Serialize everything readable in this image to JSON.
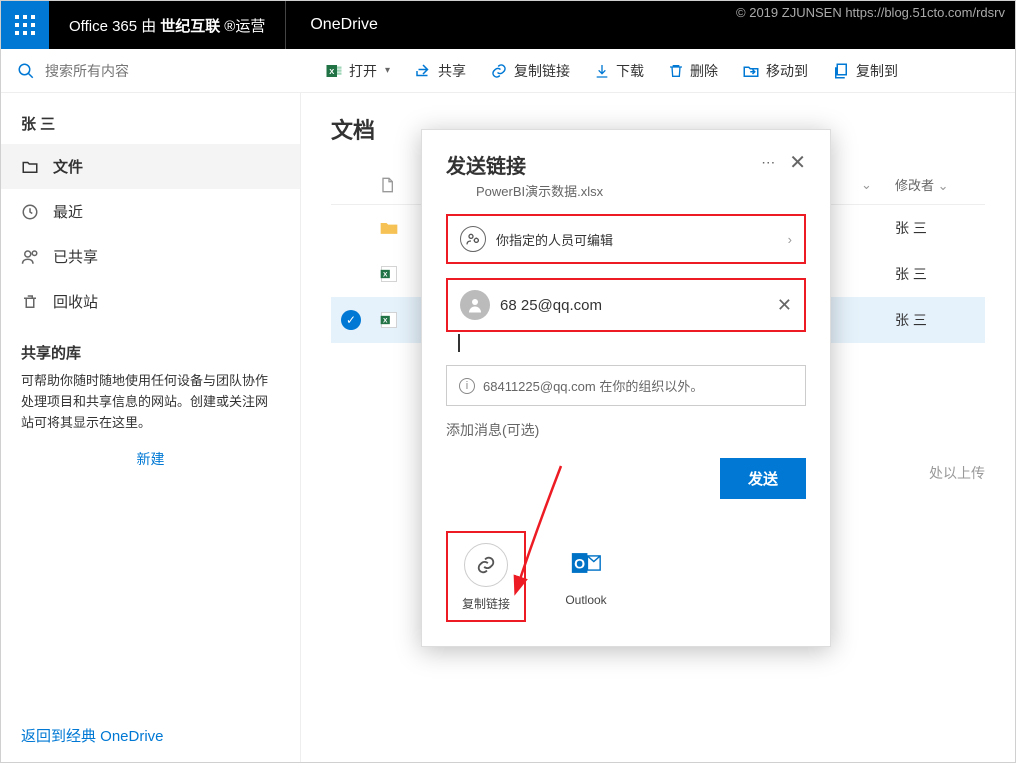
{
  "watermark": "© 2019 ZJUNSEN https://blog.51cto.com/rdsrv",
  "topbar": {
    "brand_prefix": "Office 365 由",
    "brand_bold": "世纪互联",
    "brand_suffix": "®运营",
    "product": "OneDrive"
  },
  "search": {
    "placeholder": "搜索所有内容"
  },
  "commands": {
    "open": "打开",
    "share": "共享",
    "copylink": "复制链接",
    "download": "下载",
    "delete": "删除",
    "moveto": "移动到",
    "copyto": "复制到"
  },
  "sidebar": {
    "user": "张 三",
    "files": "文件",
    "recent": "最近",
    "shared": "已共享",
    "recycle": "回收站",
    "shared_libs_hdr": "共享的库",
    "help_text": "可帮助你随时随地使用任何设备与团队协作处理项目和共享信息的网站。创建或关注网站可将其显示在这里。",
    "new_link": "新建",
    "return_link": "返回到经典 OneDrive"
  },
  "content": {
    "title": "文档",
    "cols": {
      "name_chev": "",
      "modified_by": "修改者"
    },
    "rows": [
      {
        "type": "folder",
        "modified_by": "张 三"
      },
      {
        "type": "excel",
        "modified_by": "张 三"
      },
      {
        "type": "excel",
        "selected": true,
        "modified_by": "张 三"
      }
    ],
    "upload_hint": "处以上传"
  },
  "dialog": {
    "title": "发送链接",
    "filename": "PowerBI演示数据.xlsx",
    "permission_text": "你指定的人员可编辑",
    "recipient_email_display": "68          25@qq.com",
    "info_text": "68411225@qq.com 在你的组织以外。",
    "msg_placeholder": "添加消息(可选)",
    "send_btn": "发送",
    "action_copylink": "复制链接",
    "action_outlook": "Outlook"
  }
}
